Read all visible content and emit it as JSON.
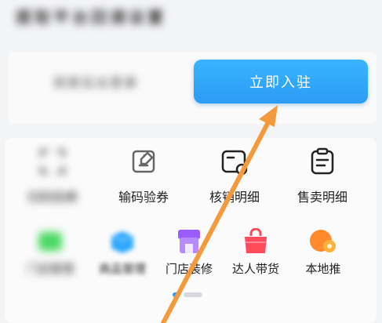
{
  "header": {
    "title": "提取平台回调设置"
  },
  "entry": {
    "secondary_label": "商家后台登录",
    "primary_label": "立即入驻"
  },
  "tools": [
    {
      "label": "扫码验券",
      "icon": "scan-icon"
    },
    {
      "label": "输码验券",
      "icon": "edit-code-icon"
    },
    {
      "label": "核销明细",
      "icon": "verify-detail-icon"
    },
    {
      "label": "售卖明细",
      "icon": "sales-detail-icon"
    }
  ],
  "apps": [
    {
      "label": "门店管理",
      "icon": "green-card-icon",
      "color": "#4cd964"
    },
    {
      "label": "商品管理",
      "icon": "blue-box-icon",
      "color": "#2fa8ff"
    },
    {
      "label": "门店装修",
      "icon": "purple-store-icon",
      "color": "#9b5cff"
    },
    {
      "label": "达人带货",
      "icon": "red-bag-icon",
      "color": "#ff4b5c"
    },
    {
      "label": "本地推",
      "icon": "orange-promo-icon",
      "color": "#ff8a2b"
    }
  ],
  "annotation": {
    "icon": "pointer-arrow-icon",
    "color": "#f59a3c"
  },
  "colors": {
    "accent": "#2b9cf5"
  }
}
